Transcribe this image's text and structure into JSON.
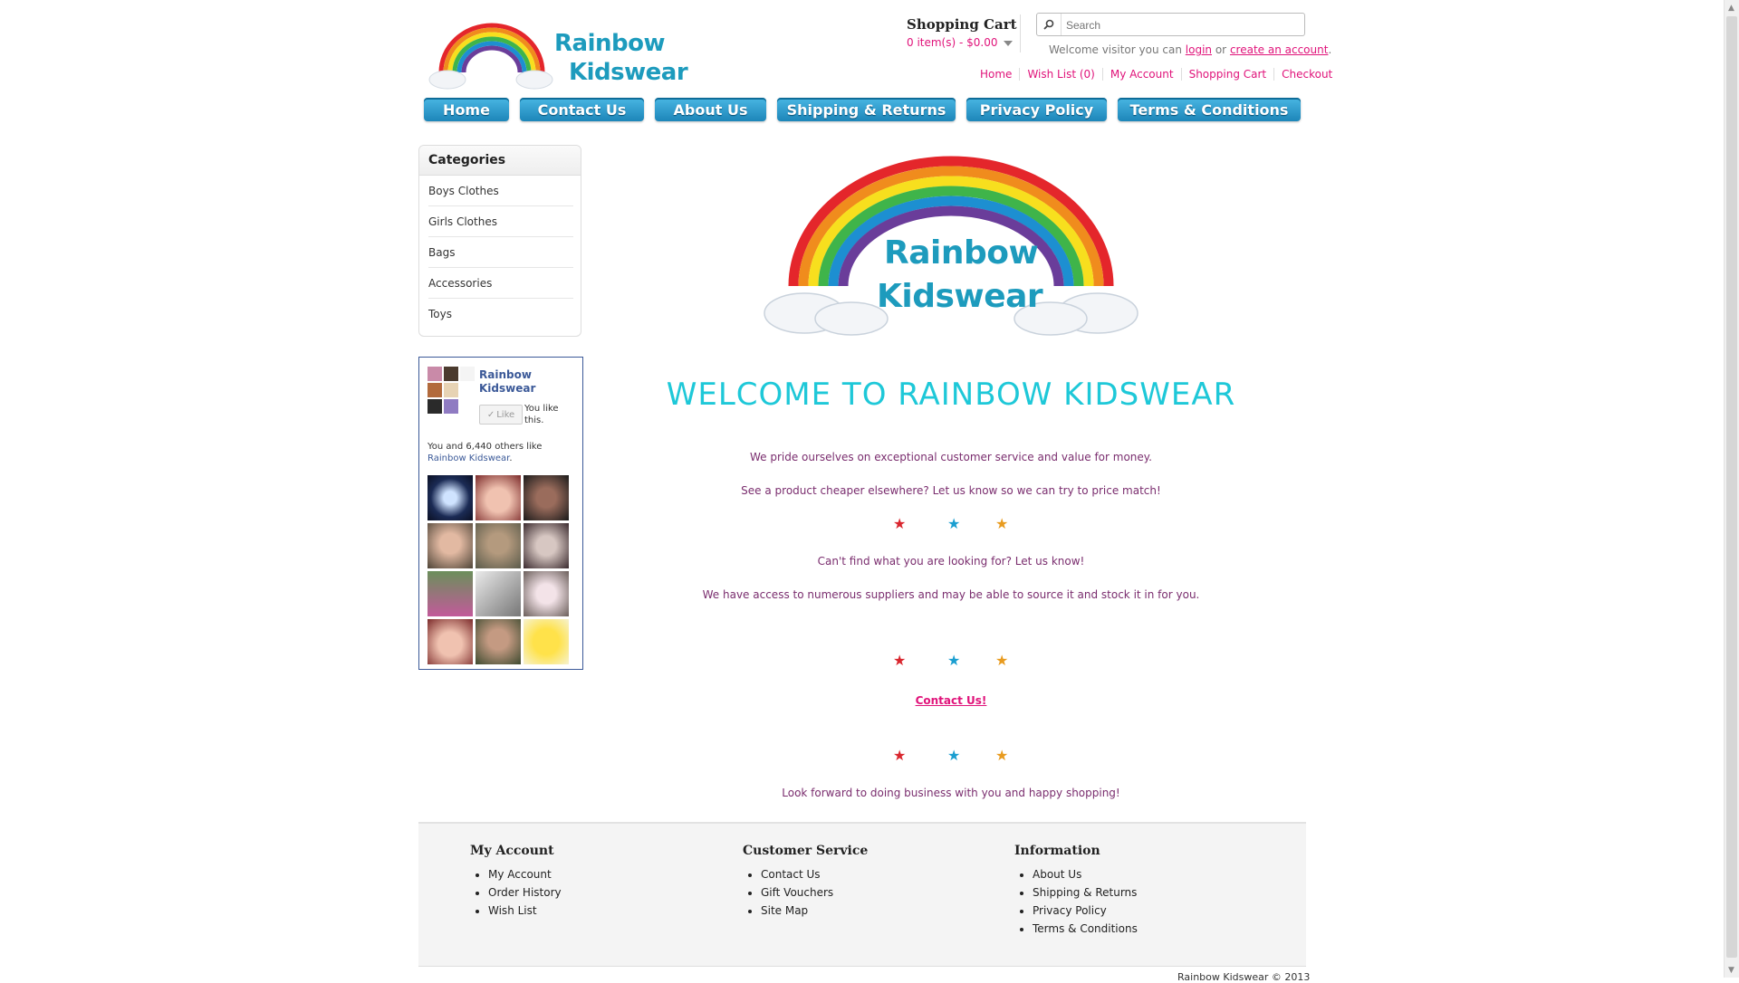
{
  "header": {
    "logo_line1": "Rainbow",
    "logo_line2": "Kidswear",
    "cart_title": "Shopping Cart",
    "cart_total": "0 item(s) - $0.00",
    "search_placeholder": "Search",
    "welcome_prefix": "Welcome visitor you can",
    "login_link": "login",
    "welcome_or": "or",
    "create_account_link": "create an account",
    "welcome_suffix": ".",
    "top_links": [
      "Home",
      "Wish List (0)",
      "My Account",
      "Shopping Cart",
      "Checkout"
    ]
  },
  "nav": [
    "Home",
    "Contact Us",
    "About Us",
    "Shipping & Returns",
    "Privacy Policy",
    "Terms & Conditions"
  ],
  "categories": {
    "title": "Categories",
    "items": [
      "Boys Clothes",
      "Girls Clothes",
      "Bags",
      "Accessories",
      "Toys"
    ]
  },
  "facebook": {
    "page_name_line1": "Rainbow",
    "page_name_line2": "Kidswear",
    "like_button": "Like",
    "you_like_line1": "You like",
    "you_like_line2": "this.",
    "count_text": "You and 6,440 others like",
    "count_link": "Rainbow Kidswear",
    "count_suffix": "."
  },
  "main": {
    "hero_logo_line1": "Rainbow",
    "hero_logo_line2": "Kidswear",
    "welcome_title": "WELCOME TO RAINBOW KIDSWEAR",
    "p1": "We pride ourselves on exceptional customer service and value for money.",
    "p2": "See a product cheaper elsewhere?  Let us know so we can try to price match!",
    "p3": "Can't find what you are looking for?  Let us know!",
    "p4": "We have access to numerous suppliers and may be able to source it and stock it in for you.",
    "contact_link": "Contact Us!",
    "p5": "Look forward to doing business with you and happy shopping!",
    "star_colors": [
      "#d9262e",
      "#1a9ed0",
      "#e89b1f"
    ]
  },
  "footer": {
    "columns": [
      {
        "title": "My Account",
        "items": [
          "My Account",
          "Order History",
          "Wish List"
        ]
      },
      {
        "title": "Customer Service",
        "items": [
          "Contact Us",
          "Gift Vouchers",
          "Site Map"
        ]
      },
      {
        "title": "Information",
        "items": [
          "About Us",
          "Shipping & Returns",
          "Privacy Policy",
          "Terms & Conditions"
        ]
      }
    ],
    "copyright": "Rainbow Kidswear © 2013"
  },
  "colors": {
    "accent_pink": "#e0137a",
    "title_cyan": "#1ec8d8",
    "text_purple": "#7a2d6e",
    "nav_blue": "#1d86b9"
  }
}
